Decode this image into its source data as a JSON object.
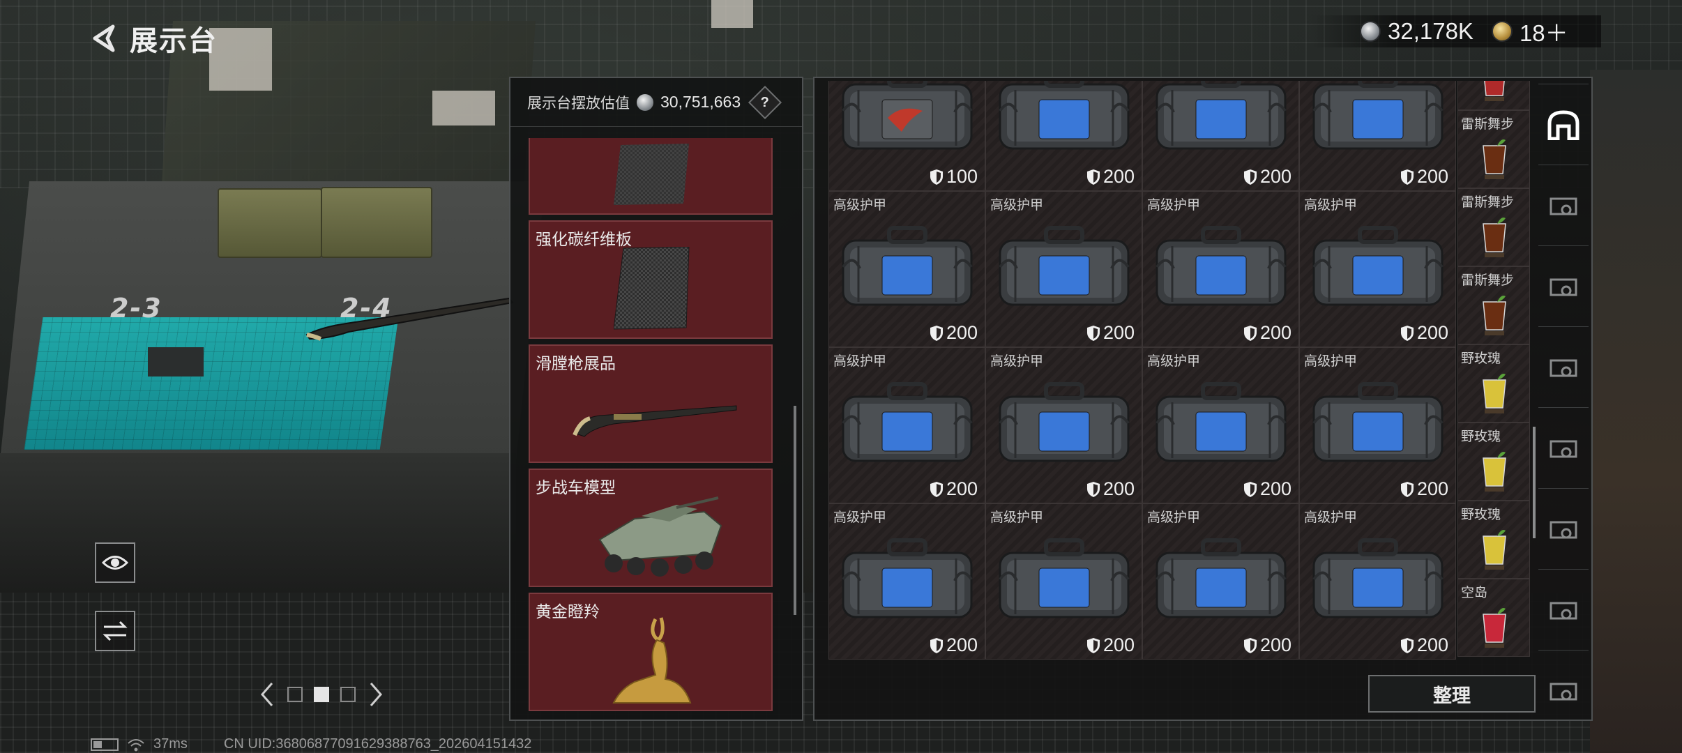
{
  "header": {
    "title": "展示台",
    "currency_value": "32,178K",
    "gold_value": "18＋"
  },
  "scene": {
    "slot_left": "2-3",
    "slot_right": "2-4"
  },
  "display_panel": {
    "label": "展示台摆放估值",
    "value": "30,751,663",
    "help": "?",
    "cards": [
      {
        "name": ""
      },
      {
        "name": "强化碳纤维板"
      },
      {
        "name": "滑膛枪展品"
      },
      {
        "name": "步战车模型"
      },
      {
        "name": "黄金瞪羚"
      }
    ]
  },
  "inventory": {
    "rows": [
      {
        "cells": [
          {
            "name": "",
            "durability": "100",
            "variant": "red"
          },
          {
            "name": "",
            "durability": "200",
            "variant": "blue"
          },
          {
            "name": "",
            "durability": "200",
            "variant": "blue"
          },
          {
            "name": "",
            "durability": "200",
            "variant": "blue"
          }
        ]
      },
      {
        "cells": [
          {
            "name": "高级护甲",
            "durability": "200",
            "variant": "blue"
          },
          {
            "name": "高级护甲",
            "durability": "200",
            "variant": "blue"
          },
          {
            "name": "高级护甲",
            "durability": "200",
            "variant": "blue"
          },
          {
            "name": "高级护甲",
            "durability": "200",
            "variant": "blue"
          }
        ]
      },
      {
        "cells": [
          {
            "name": "高级护甲",
            "durability": "200",
            "variant": "blue"
          },
          {
            "name": "高级护甲",
            "durability": "200",
            "variant": "blue"
          },
          {
            "name": "高级护甲",
            "durability": "200",
            "variant": "blue"
          },
          {
            "name": "高级护甲",
            "durability": "200",
            "variant": "blue"
          }
        ]
      },
      {
        "cells": [
          {
            "name": "高级护甲",
            "durability": "200",
            "variant": "blue"
          },
          {
            "name": "高级护甲",
            "durability": "200",
            "variant": "blue"
          },
          {
            "name": "高级护甲",
            "durability": "200",
            "variant": "blue"
          },
          {
            "name": "高级护甲",
            "durability": "200",
            "variant": "blue"
          }
        ]
      }
    ],
    "drinks": [
      {
        "name": "",
        "color": "#b02a2a"
      },
      {
        "name": "雷斯舞步",
        "color": "#6a2e12"
      },
      {
        "name": "雷斯舞步",
        "color": "#6a2e12"
      },
      {
        "name": "雷斯舞步",
        "color": "#6a2e12"
      },
      {
        "name": "野玫瑰",
        "color": "#d9c23a"
      },
      {
        "name": "野玫瑰",
        "color": "#d9c23a"
      },
      {
        "name": "野玫瑰",
        "color": "#d9c23a"
      },
      {
        "name": "空岛",
        "color": "#c8283a"
      }
    ],
    "tidy_label": "整理"
  },
  "categories": [
    {
      "icon": "storage-icon",
      "active": true
    },
    {
      "icon": "armor-case-icon",
      "active": false
    },
    {
      "icon": "armor-case-icon",
      "active": false
    },
    {
      "icon": "armor-iv-icon",
      "active": false
    },
    {
      "icon": "armor-iv-icon",
      "active": false
    },
    {
      "icon": "armor-iv-icon",
      "active": false
    },
    {
      "icon": "gti-vehicle-icon",
      "active": false
    },
    {
      "icon": "iv-vehicle-icon",
      "active": false
    }
  ],
  "status": {
    "ping": "37ms",
    "uid": "CN UID:3680687709162938876​3_202604151432"
  }
}
